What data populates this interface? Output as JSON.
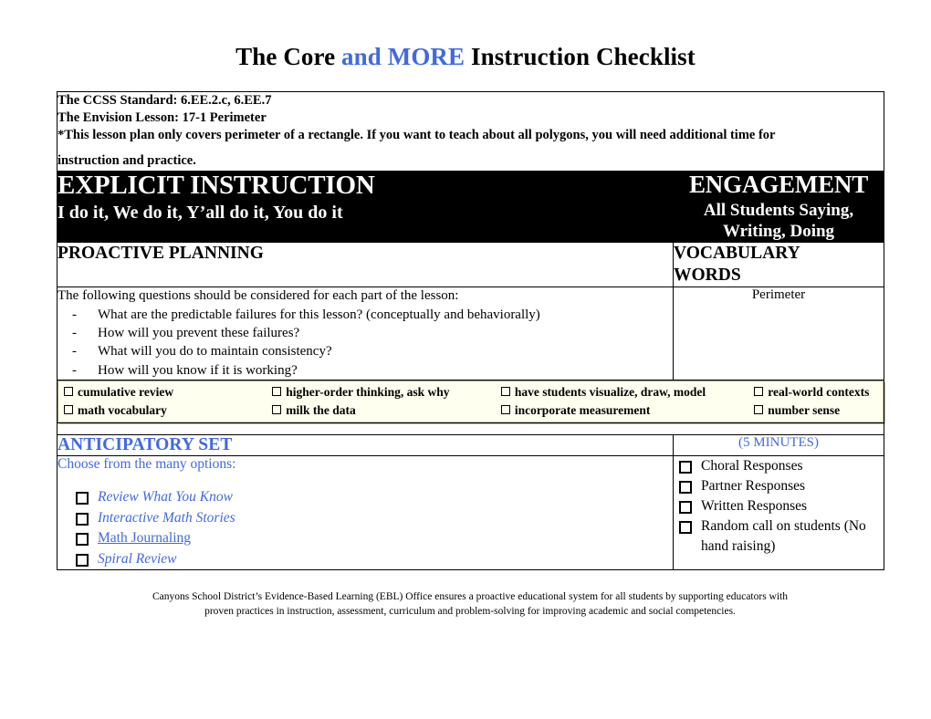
{
  "title": {
    "part1": "The Core ",
    "highlight": "and MORE",
    "part2": " Instruction Checklist",
    "highlight_color": "#4169e1"
  },
  "standards": {
    "line1": "The CCSS Standard: 6.EE.2.c, 6.EE.7",
    "line2": "The Envision Lesson: 17-1 Perimeter",
    "line3": "*This lesson plan only covers perimeter of a rectangle. If you want to teach about all polygons, you will need additional time for",
    "line4": "instruction and practice."
  },
  "banner": {
    "left_heading": "EXPLICIT INSTRUCTION",
    "left_subheading": "I do it, We do it, Y’all do it, You do it",
    "right_heading": "ENGAGEMENT",
    "right_subheading": "All Students Saying, Writing, Doing",
    "background": "#000000",
    "text_color": "#ffffff"
  },
  "proactive": {
    "heading": "PROACTIVE PLANNING",
    "intro": "The following questions should be considered for each part of the lesson:",
    "dash": "-",
    "questions": [
      "What are the predictable failures for this lesson? (conceptually and behaviorally)",
      "How will you prevent these failures?",
      "What will you do to maintain consistency?",
      "How will you know if it is working?"
    ]
  },
  "vocabulary": {
    "heading_line1": "VOCABULARY",
    "heading_line2": "WORDS",
    "words": "Perimeter"
  },
  "strategy_strip": {
    "background": "#fffff0",
    "columns": [
      [
        "cumulative review",
        "math vocabulary"
      ],
      [
        "higher-order thinking, ask why",
        "milk the data"
      ],
      [
        "have students visualize, draw, model",
        "incorporate measurement"
      ],
      [
        "real-world contexts",
        "number sense"
      ]
    ]
  },
  "anticipatory": {
    "heading": "ANTICIPATORY SET",
    "duration": "(5 MINUTES)",
    "accent_color": "#4169e1",
    "intro": "Choose from the many options:",
    "options": [
      {
        "label": "Review What You Know",
        "style": "italic"
      },
      {
        "label": "Interactive Math Stories",
        "style": "italic"
      },
      {
        "label": "Math Journaling",
        "style": "link"
      },
      {
        "label": "Spiral Review",
        "style": "italic"
      }
    ],
    "responses": [
      "Choral Responses",
      "Partner Responses",
      "Written Responses",
      "Random call on students (No hand raising)"
    ]
  },
  "footer": {
    "line1": "Canyons School District’s Evidence-Based Learning (EBL) Office ensures a proactive educational system for all students by supporting educators with",
    "line2": "proven practices in instruction, assessment, curriculum and problem-solving for improving academic and social competencies."
  }
}
